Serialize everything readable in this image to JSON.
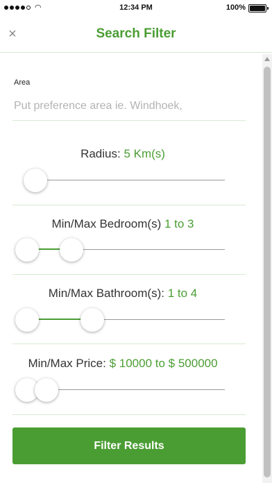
{
  "status_bar": {
    "time": "12:34 PM",
    "battery": "100%",
    "wifi_icon": "wifi-icon",
    "signal_icon": "signal-dots-icon"
  },
  "nav": {
    "title": "Search Filter",
    "close_icon": "close-icon"
  },
  "area": {
    "label": "Area",
    "placeholder": "Put preference area ie. Windhoek,",
    "value": ""
  },
  "sliders": {
    "radius": {
      "label": "Radius: ",
      "value": "5 Km(s)"
    },
    "bedroom": {
      "label": "Min/Max Bedroom(s) ",
      "value": "1 to 3"
    },
    "bathroom": {
      "label": "Min/Max Bathroom(s): ",
      "value": "1 to 4"
    },
    "price": {
      "label": "Min/Max Price: ",
      "value": "$ 10000 to $ 500000"
    }
  },
  "filter_button": {
    "label": "Filter Results"
  },
  "colors": {
    "accent": "#4a9d33",
    "divider": "#d6ead1",
    "placeholder": "#b3b3b3"
  }
}
